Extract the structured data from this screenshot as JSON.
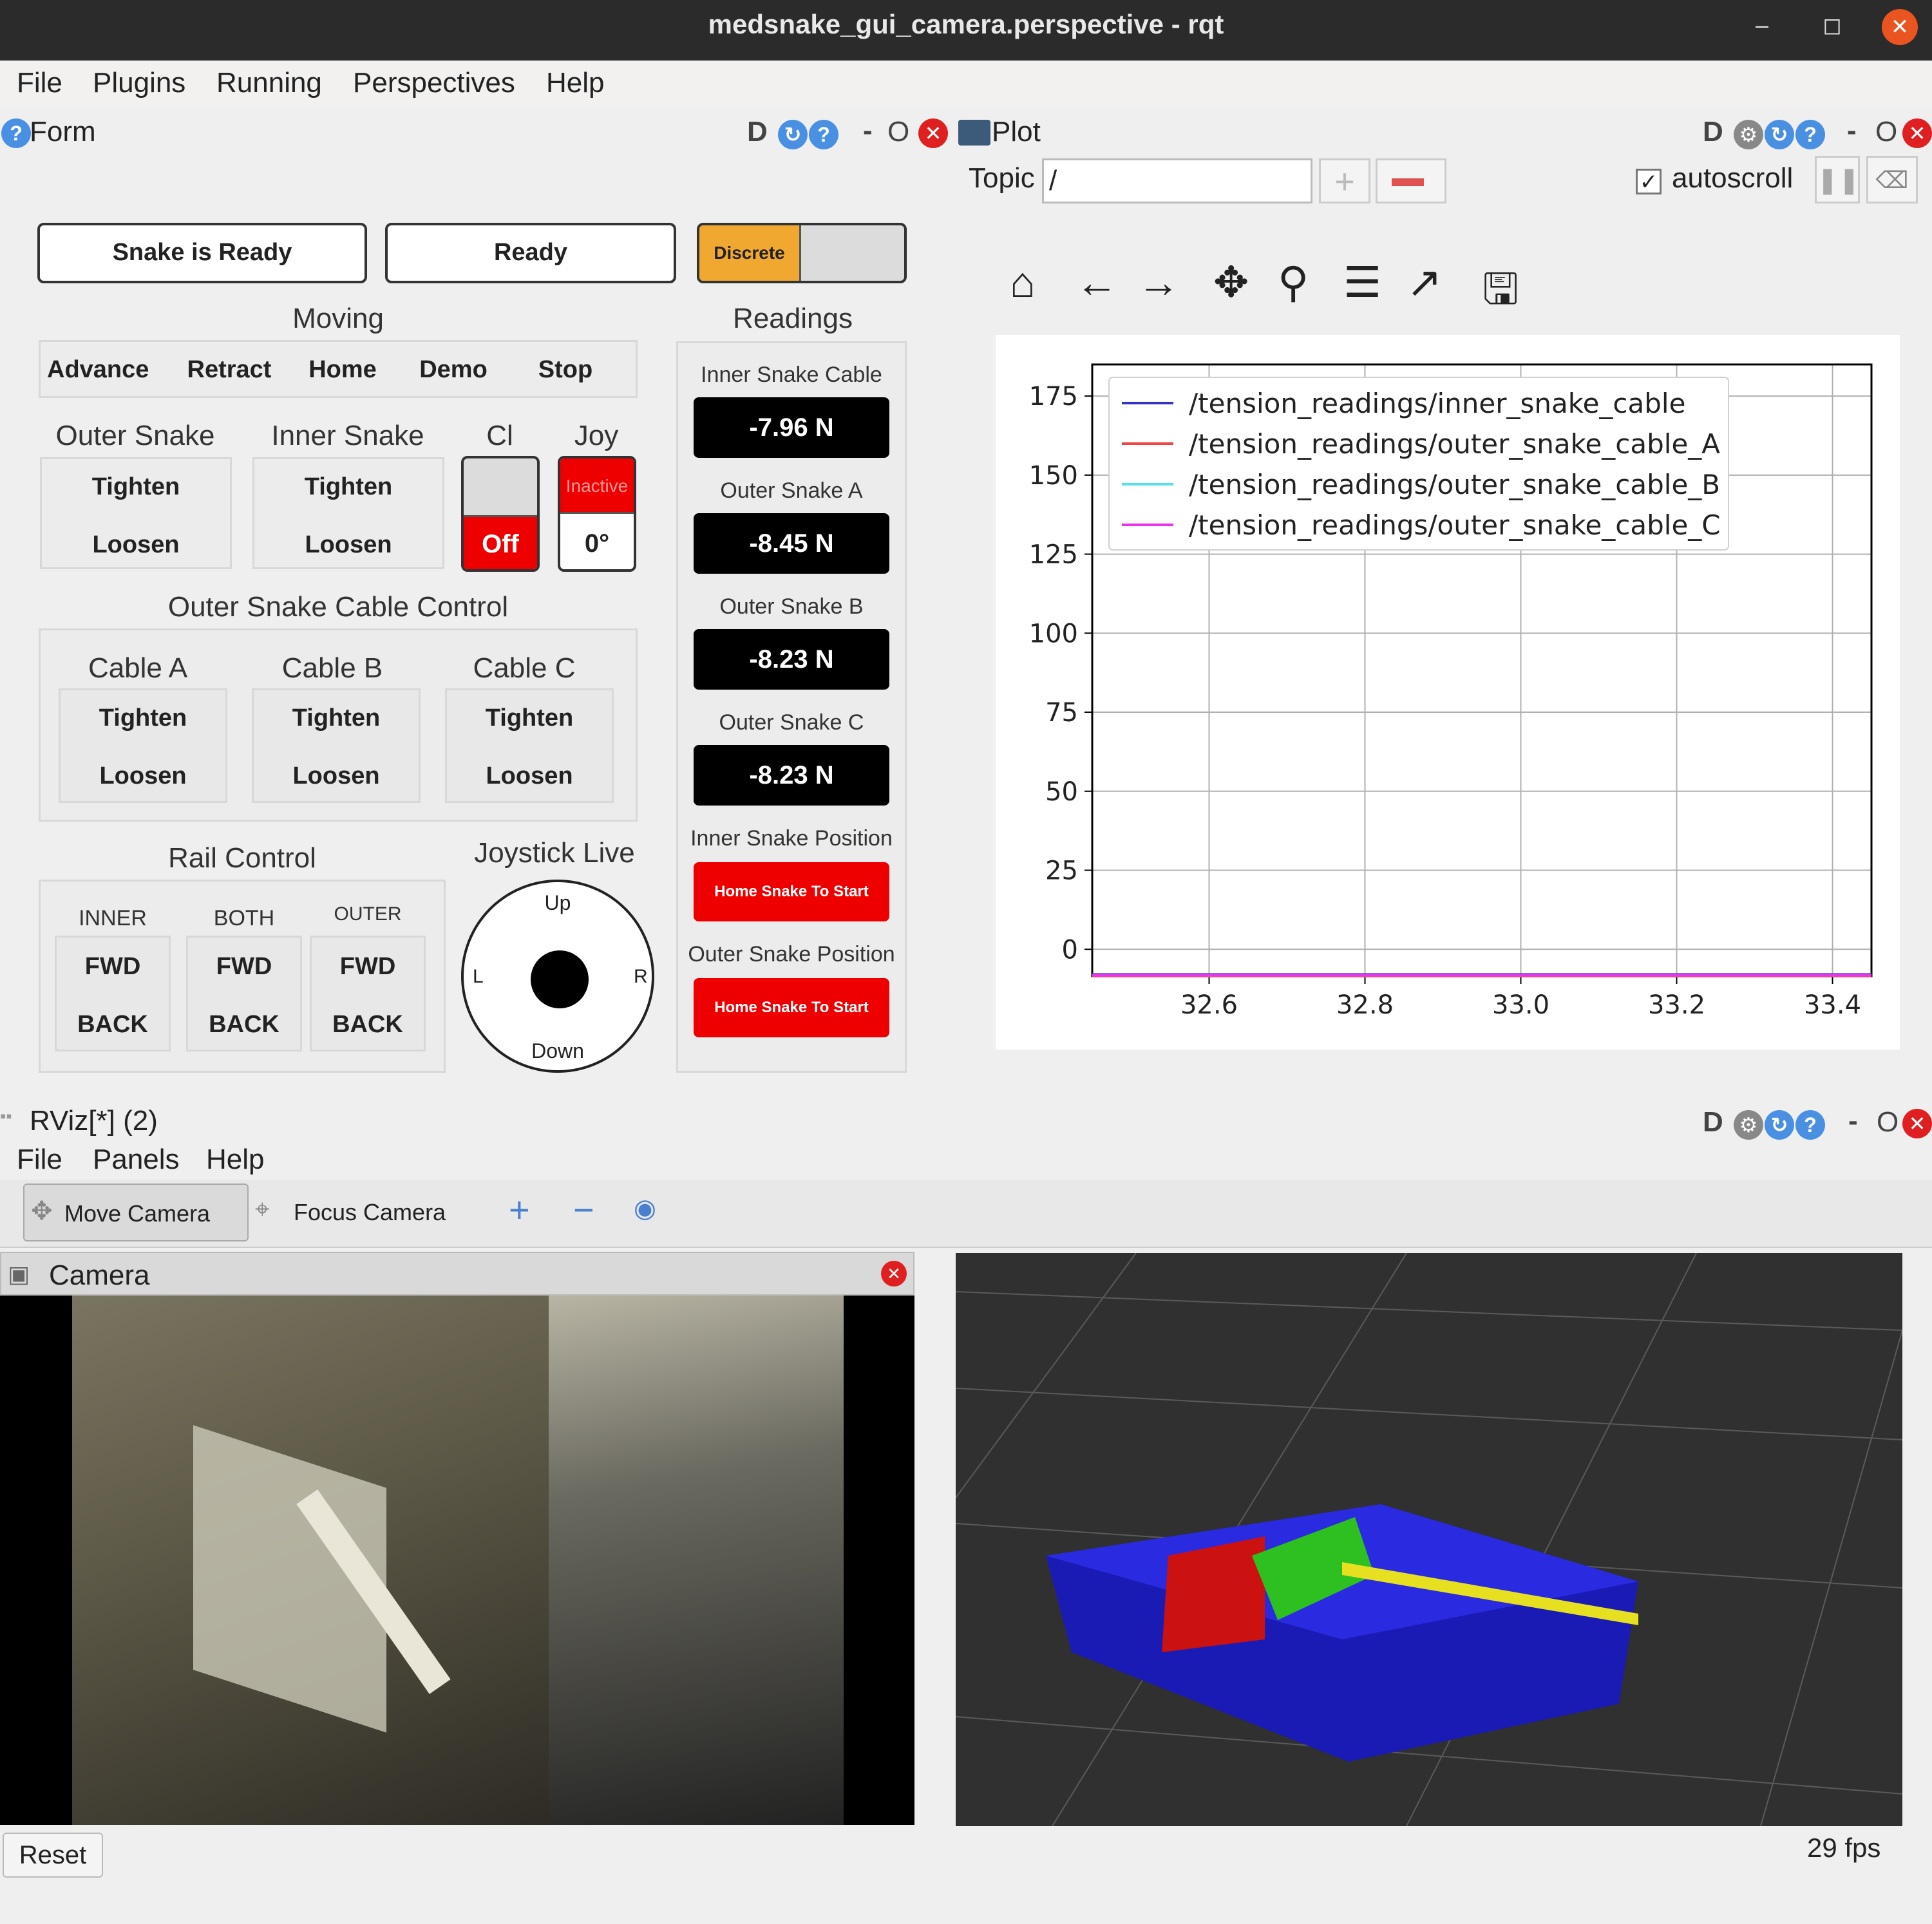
{
  "window": {
    "title": "medsnake_gui_camera.perspective - rqt",
    "minimize": "–",
    "maximize": "◻",
    "close": "✕"
  },
  "menu": [
    "File",
    "Plugins",
    "Running",
    "Perspectives",
    "Help"
  ],
  "form": {
    "title": "Form",
    "status_snake": "Snake is Ready",
    "status_ready": "Ready",
    "mode_toggle": "Discrete",
    "moving": {
      "title": "Moving",
      "buttons": [
        "Advance",
        "Retract",
        "Home",
        "Demo",
        "Stop"
      ]
    },
    "outer_snake": {
      "title": "Outer Snake",
      "tighten": "Tighten",
      "loosen": "Loosen"
    },
    "inner_snake": {
      "title": "Inner Snake",
      "tighten": "Tighten",
      "loosen": "Loosen"
    },
    "cl": {
      "title": "Cl",
      "state": "Off"
    },
    "joy": {
      "title": "Joy",
      "state": "Inactive",
      "angle": "0°"
    },
    "cable_control": {
      "title": "Outer Snake Cable Control",
      "cables": [
        {
          "name": "Cable A",
          "tighten": "Tighten",
          "loosen": "Loosen"
        },
        {
          "name": "Cable B",
          "tighten": "Tighten",
          "loosen": "Loosen"
        },
        {
          "name": "Cable C",
          "tighten": "Tighten",
          "loosen": "Loosen"
        }
      ]
    },
    "rail": {
      "title": "Rail Control",
      "groups": [
        {
          "name": "INNER",
          "fwd": "FWD",
          "back": "BACK"
        },
        {
          "name": "BOTH",
          "fwd": "FWD",
          "back": "BACK"
        },
        {
          "name": "OUTER",
          "fwd": "FWD",
          "back": "BACK"
        }
      ]
    },
    "joystick": {
      "title": "Joystick Live",
      "up": "Up",
      "down": "Down",
      "left": "L",
      "right": "R"
    },
    "readings": {
      "title": "Readings",
      "items": [
        {
          "label": "Inner Snake Cable",
          "value": "-7.96 N"
        },
        {
          "label": "Outer Snake A",
          "value": "-8.45 N"
        },
        {
          "label": "Outer Snake B",
          "value": "-8.23 N"
        },
        {
          "label": "Outer Snake C",
          "value": "-8.23 N"
        }
      ],
      "inner_pos_label": "Inner Snake Position",
      "inner_pos_button": "Home Snake To Start",
      "outer_pos_label": "Outer Snake Position",
      "outer_pos_button": "Home Snake To Start"
    }
  },
  "plot": {
    "title": "Plot",
    "topic_label": "Topic",
    "topic_value": "/",
    "autoscroll": "autoscroll"
  },
  "chart_data": {
    "type": "line",
    "x_ticks": [
      "32.6",
      "32.8",
      "33.0",
      "33.2",
      "33.4"
    ],
    "y_ticks": [
      "175",
      "150",
      "125",
      "100",
      "75",
      "50",
      "25",
      "0"
    ],
    "xlim": [
      32.45,
      33.45
    ],
    "ylim": [
      -8.5,
      185
    ],
    "grid": true,
    "legend_position": "top-left",
    "series": [
      {
        "name": "/tension_readings/inner_snake_cable",
        "color": "#3333cc",
        "x": [
          32.45,
          33.45
        ],
        "y": [
          -7.96,
          -7.96
        ]
      },
      {
        "name": "/tension_readings/outer_snake_cable_A",
        "color": "#ee4444",
        "x": [
          32.45,
          33.45
        ],
        "y": [
          -8.45,
          -8.45
        ]
      },
      {
        "name": "/tension_readings/outer_snake_cable_B",
        "color": "#55e0ee",
        "x": [
          32.45,
          33.45
        ],
        "y": [
          -8.23,
          -8.23
        ]
      },
      {
        "name": "/tension_readings/outer_snake_cable_C",
        "color": "#ee33ee",
        "x": [
          32.45,
          33.45
        ],
        "y": [
          -8.23,
          -8.23
        ]
      }
    ]
  },
  "rviz": {
    "title": "RViz[*] (2)",
    "menu": [
      "File",
      "Panels",
      "Help"
    ],
    "move_camera": "Move Camera",
    "focus_camera": "Focus Camera",
    "camera_panel": "Camera",
    "reset": "Reset",
    "fps": "29 fps"
  },
  "colors": {
    "accent_orange": "#f0a830",
    "red": "#ee0000",
    "titlebar": "#2b2b2b"
  }
}
